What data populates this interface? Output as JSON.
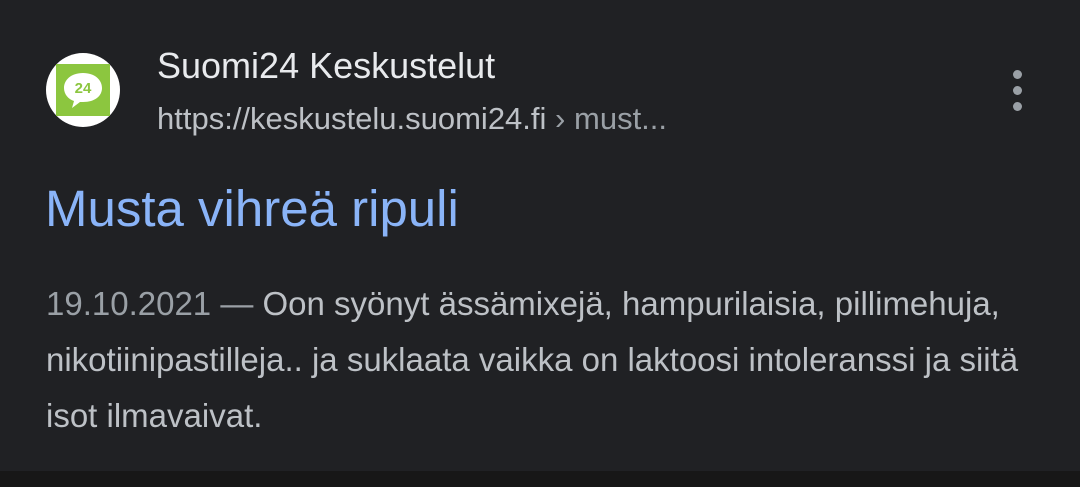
{
  "result": {
    "favicon": {
      "icon": "suomi24-logo-icon",
      "text": "24",
      "color": "#8cc63f"
    },
    "site_name": "Suomi24 Keskustelut",
    "url": {
      "domain": "https://keskustelu.suomi24.fi",
      "separator": "›",
      "path": "must..."
    },
    "more_icon": "more-vert-icon",
    "title": "Musta vihreä ripuli",
    "snippet": {
      "date": "19.10.2021",
      "dash": "—",
      "text": "Oon syönyt ässämixejä, hampurilaisia, pillimehuja, nikotiinipastilleja.. ja suklaata vaikka on laktoosi intoleranssi ja siitä isot ilmavaivat."
    }
  },
  "colors": {
    "background": "#202124",
    "title_link": "#8ab4f8",
    "primary_text": "#e8eaed",
    "secondary_text": "#bdc1c6",
    "muted_text": "#9aa0a6"
  }
}
